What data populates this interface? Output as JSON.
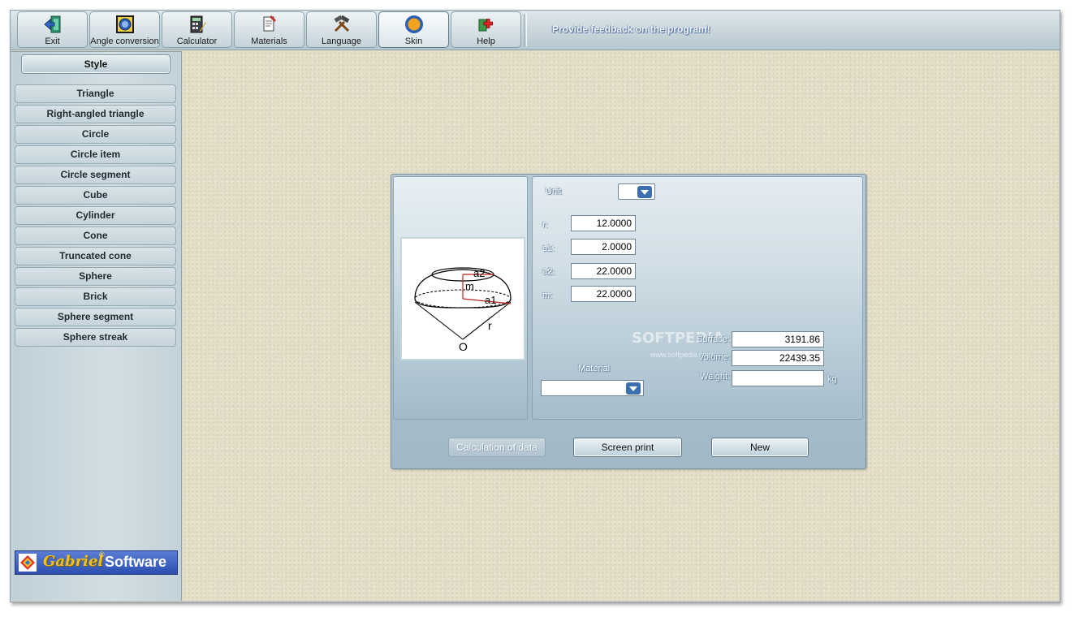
{
  "toolbar": {
    "buttons": [
      {
        "label": "Exit",
        "icon": "exit-door-icon"
      },
      {
        "label": "Angle conversion",
        "icon": "angle-icon"
      },
      {
        "label": "Calculator",
        "icon": "calculator-icon"
      },
      {
        "label": "Materials",
        "icon": "materials-icon"
      },
      {
        "label": "Language",
        "icon": "tools-icon"
      },
      {
        "label": "Skin",
        "icon": "skin-icon",
        "active": true
      },
      {
        "label": "Help",
        "icon": "help-icon"
      }
    ],
    "feedback": "Provide feedback on the program!"
  },
  "sidebar": {
    "style_label": "Style",
    "items": [
      {
        "label": "Triangle"
      },
      {
        "label": "Right-angled triangle"
      },
      {
        "label": "Circle"
      },
      {
        "label": "Circle item"
      },
      {
        "label": "Circle segment"
      },
      {
        "label": "Cube"
      },
      {
        "label": "Cylinder"
      },
      {
        "label": "Cone"
      },
      {
        "label": "Truncated cone"
      },
      {
        "label": "Sphere"
      },
      {
        "label": "Brick"
      },
      {
        "label": "Sphere segment"
      },
      {
        "label": "Sphere streak"
      }
    ],
    "brand": {
      "name1": "Gabriel",
      "reg": "®",
      "name2": "Software"
    }
  },
  "dialog": {
    "figure_labels": {
      "a2": "a2",
      "m": "m",
      "a1": "a1",
      "r": "r",
      "o": "O"
    },
    "unit_label": "Unit",
    "unit_value": "",
    "inputs": [
      {
        "label": "r:",
        "value": "12.0000"
      },
      {
        "label": "a1:",
        "value": "2.0000"
      },
      {
        "label": "a2:",
        "value": "22.0000"
      },
      {
        "label": "m:",
        "value": "22.0000"
      }
    ],
    "results": {
      "surface_label": "Surface:",
      "surface_value": "3191.86",
      "volume_label": "Volume:",
      "volume_value": "22439.35",
      "weight_label": "Weight:",
      "weight_value": "",
      "weight_unit": "kg"
    },
    "material_label": "Material",
    "material_value": "",
    "watermark": "SOFTPEDIA",
    "watermark_sub": "www.softpedia.com",
    "buttons": {
      "calculation": "Calculation of data",
      "screen_print": "Screen print",
      "new": "New"
    }
  },
  "colors": {
    "accent": "#2c4fb0",
    "panel": "#b6c9d5",
    "background": "#e4dec9"
  }
}
